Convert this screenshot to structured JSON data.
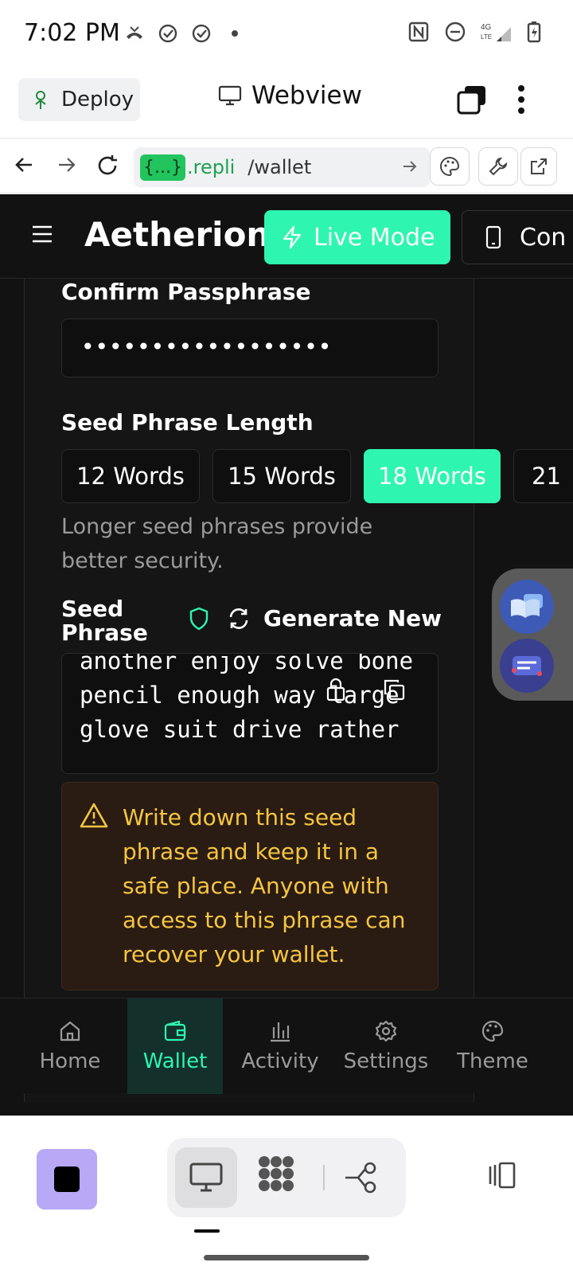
{
  "status_bar": {
    "time": "7:02 PM"
  },
  "header": {
    "deploy_label": "Deploy",
    "webview_label": "Webview"
  },
  "url_bar": {
    "badge": "{...}",
    "domain": ".repli",
    "path": "/wallet"
  },
  "app": {
    "brand": "Aetherion",
    "live_mode_label": "Live Mode",
    "connect_label": "Con"
  },
  "form": {
    "confirm_label": "Confirm Passphrase",
    "confirm_value": "••••••••••••••••••",
    "seed_length_label": "Seed Phrase Length",
    "seed_length_options": [
      "12 Words",
      "15 Words",
      "18 Words",
      "21"
    ],
    "seed_length_selected": "18 Words",
    "help_text": "Longer seed phrases provide better security.",
    "seed_phrase_label": "Seed Phrase",
    "generate_label": "Generate New",
    "seed_text": "another enjoy solve bone pencil enough way large glove suit drive rather",
    "warning_text": "Write down this seed phrase and keep it in a safe place. Anyone with access to this phrase can recover your wallet."
  },
  "bottom_nav": [
    {
      "label": "Home",
      "icon": "home-icon"
    },
    {
      "label": "Wallet",
      "icon": "wallet-icon",
      "active": true
    },
    {
      "label": "Activity",
      "icon": "activity-icon"
    },
    {
      "label": "Settings",
      "icon": "gear-icon"
    },
    {
      "label": "Theme",
      "icon": "palette-icon"
    }
  ],
  "colors": {
    "accent": "#2ef5b0",
    "background": "#121212",
    "warning": "#f5c542"
  }
}
